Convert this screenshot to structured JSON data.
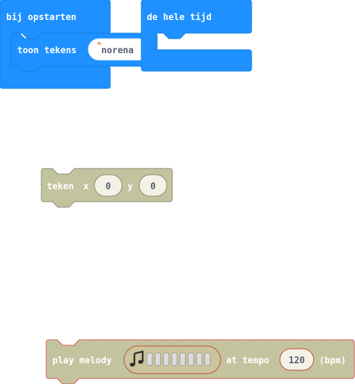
{
  "blocks": {
    "on_start": {
      "label": "bij opstarten"
    },
    "forever": {
      "label": "de hele tijd"
    },
    "show_string": {
      "label": "toon tekens",
      "value": "norena",
      "open_quote": "\"",
      "close_quote": "\""
    },
    "plot": {
      "label": "teken",
      "x_label": "x",
      "x_value": "0",
      "y_label": "y",
      "y_value": "0"
    },
    "play_melody": {
      "label": "play melody",
      "tempo_label": "at tempo",
      "tempo_value": "120",
      "unit_label": "(bpm)",
      "melody_icon": "music-note-icon"
    }
  },
  "colors": {
    "basic_blue": "#1e90ff",
    "basic_blue_border": "#1a7fe0",
    "disabled_fill": "#c8c4a0",
    "disabled_border": "#8a8a72",
    "music_border": "#d9534f",
    "field_fill": "#ffffff"
  }
}
